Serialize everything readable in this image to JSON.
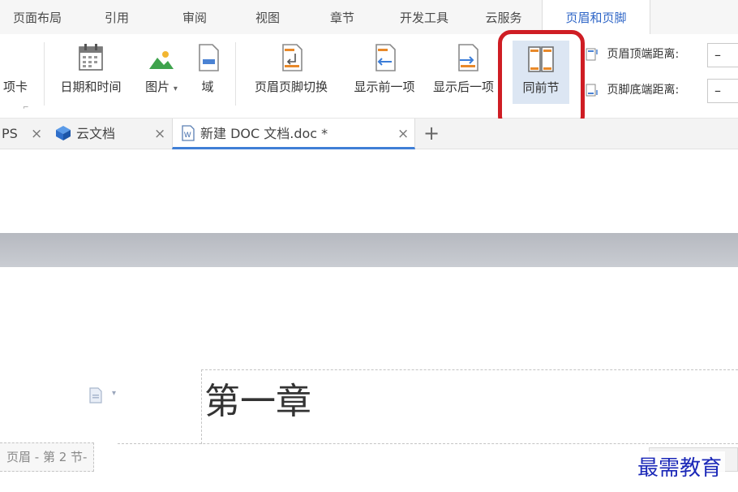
{
  "menu": {
    "tabs": [
      {
        "label": "页面布局"
      },
      {
        "label": "引用"
      },
      {
        "label": "审阅"
      },
      {
        "label": "视图"
      },
      {
        "label": "章节"
      },
      {
        "label": "开发工具"
      },
      {
        "label": "云服务"
      },
      {
        "label": "页眉和页脚"
      }
    ],
    "active_tab": "页眉和页脚"
  },
  "ribbon": {
    "tab_card_partial": "项卡",
    "date_time": "日期和时间",
    "picture": "图片",
    "picture_arrow": "▾",
    "field": "域",
    "switch_header_footer": "页眉页脚切换",
    "show_previous": "显示前一项",
    "show_next": "显示后一项",
    "same_as_previous": "同前节",
    "header_top_distance": "页眉顶端距离:",
    "footer_bottom_distance": "页脚底端距离:",
    "header_top_value": "–",
    "footer_bottom_value": "–"
  },
  "doc_tabs": {
    "items": [
      {
        "label": "PS"
      },
      {
        "label": "云文档"
      },
      {
        "label": "新建 DOC 文档.doc *"
      }
    ],
    "close_glyph": "×",
    "add_glyph": "+"
  },
  "document": {
    "header_text": "第一章",
    "header_section_label": "页眉 - 第 2 节-"
  },
  "watermark": "最需教育",
  "colors": {
    "accent": "#2f66c7",
    "highlight": "#cf1d24",
    "watermark": "#1b28b8"
  }
}
